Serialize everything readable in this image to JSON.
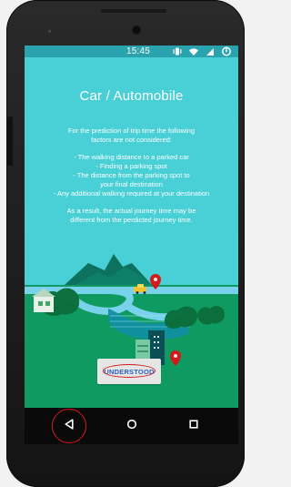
{
  "status_bar": {
    "time": "15:45"
  },
  "dialog": {
    "title": "Car / Automobile",
    "body": "For the prediction of trip time the following\nfactors are not considered:\n\n- The walking distance to a parked car\n- Finding a parking spot\n- The distance from the parking spot to\nyour final destination\n- Any additional walking required at your destination\n\nAs a result, the actual journey time may be\ndifferent from the perdicted journey time.",
    "button_label": "UNDERSTOOD"
  },
  "colors": {
    "background": "#49cfd6",
    "status_bar": "#2ba3ae",
    "nav_bar": "#0a0a0a",
    "button_text": "#2b5fc4",
    "highlight_ring": "#d31b1b",
    "ground": "#0f9a61",
    "road": "#78d3ea",
    "water": "#118fa1",
    "car": "#f1c12b"
  },
  "icons": {
    "status": [
      "vibrate-icon",
      "wifi-icon",
      "signal-icon",
      "battery-icon"
    ],
    "nav": [
      "back-icon",
      "home-icon",
      "recents-icon"
    ]
  }
}
